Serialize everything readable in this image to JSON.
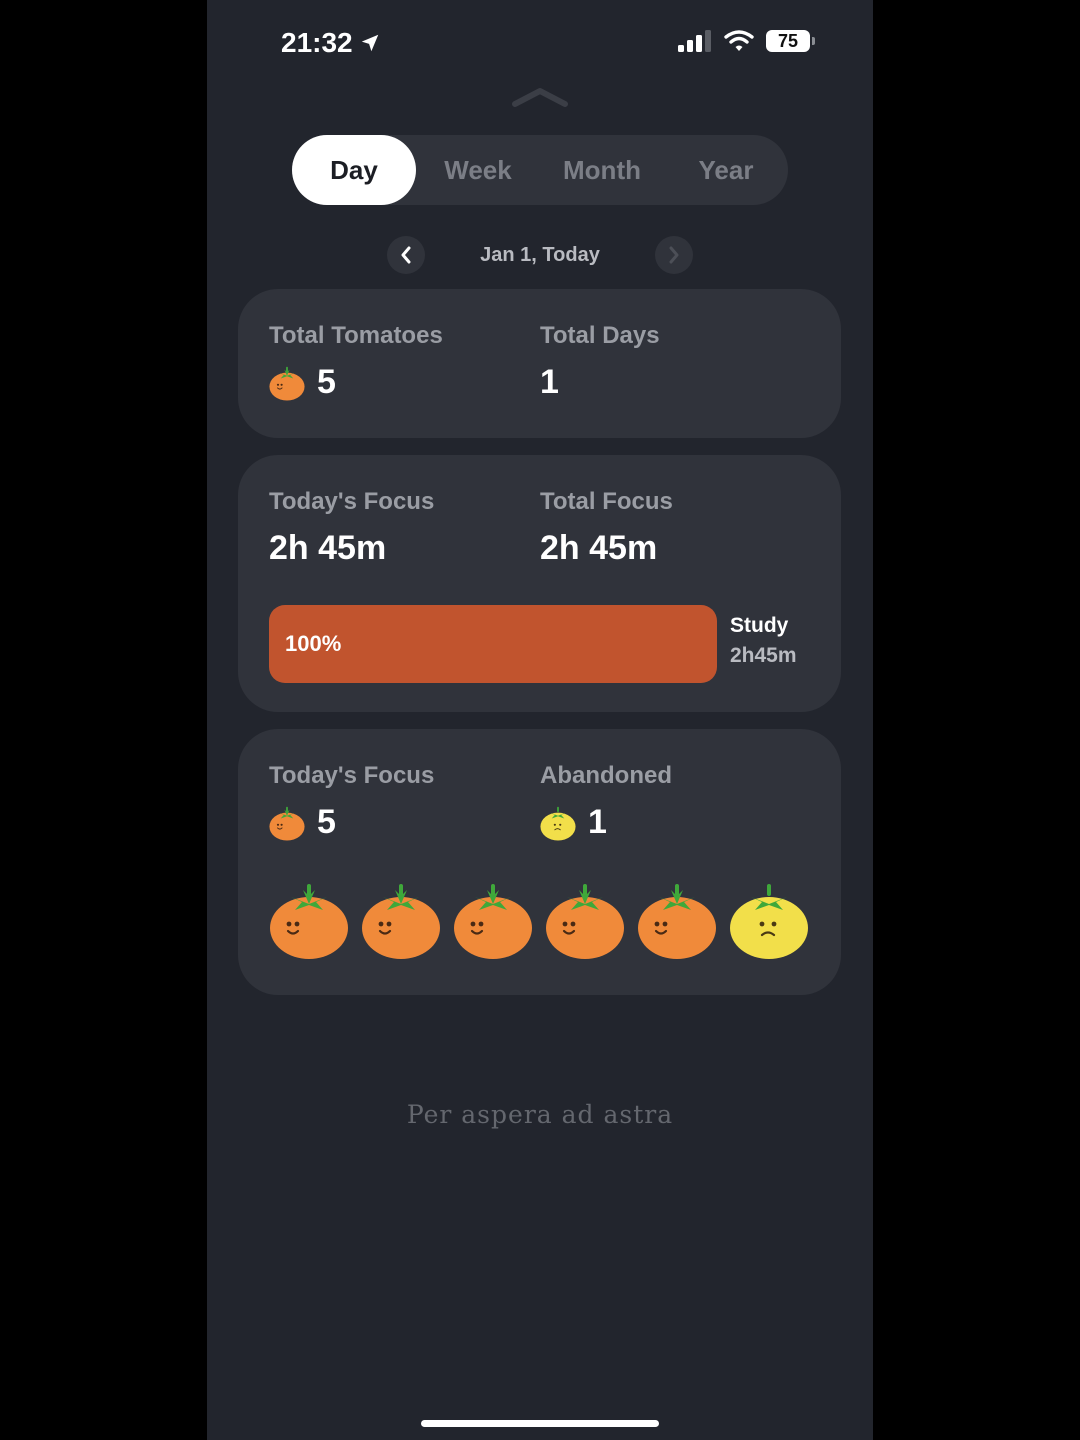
{
  "status": {
    "time": "21:32",
    "battery": "75"
  },
  "tabs": [
    {
      "label": "Day",
      "active": true
    },
    {
      "label": "Week",
      "active": false
    },
    {
      "label": "Month",
      "active": false
    },
    {
      "label": "Year",
      "active": false
    }
  ],
  "date_nav": {
    "label": "Jan 1, Today"
  },
  "summary_card": {
    "total_tomatoes_label": "Total Tomatoes",
    "total_tomatoes_value": "5",
    "total_days_label": "Total Days",
    "total_days_value": "1"
  },
  "focus_card": {
    "todays_focus_label": "Today's Focus",
    "todays_focus_value": "2h 45m",
    "total_focus_label": "Total Focus",
    "total_focus_value": "2h 45m",
    "bar": {
      "percent_label": "100%",
      "fill_fraction": 1.0,
      "category": "Study",
      "duration": "2h45m",
      "color": "#c1542e"
    }
  },
  "tomato_card": {
    "todays_focus_label": "Today's Focus",
    "todays_focus_count": "5",
    "abandoned_label": "Abandoned",
    "abandoned_count": "1",
    "tomatoes": [
      "completed",
      "completed",
      "completed",
      "completed",
      "completed",
      "abandoned"
    ]
  },
  "colors": {
    "background": "#22252d",
    "card": "#30333b",
    "accent": "#c1542e",
    "tomato_orange": "#f08a3a",
    "tomato_yellow": "#f2df4a",
    "stem_green": "#3fa83a"
  },
  "icons": {
    "location": "location-arrow-icon",
    "signal": "signal-bars-icon",
    "wifi": "wifi-icon",
    "prev": "chevron-left-icon",
    "next": "chevron-right-icon",
    "collapse": "chevron-up-icon",
    "tomato": "tomato-icon",
    "sad_tomato": "sad-tomato-icon"
  },
  "footer": {
    "motto": "Per aspera ad astra"
  }
}
